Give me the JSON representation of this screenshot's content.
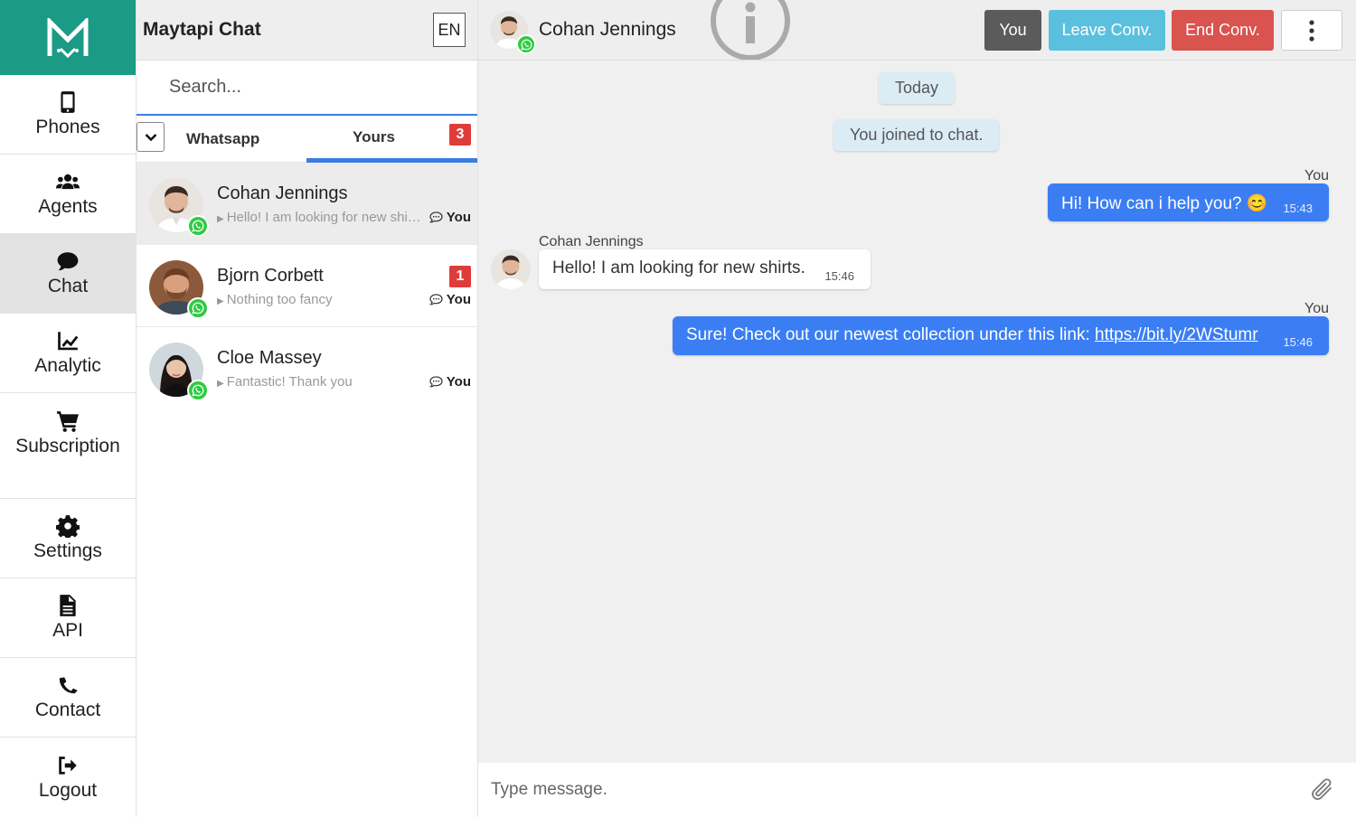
{
  "nav": {
    "items": [
      {
        "label": "Phones",
        "icon": "phone-icon"
      },
      {
        "label": "Agents",
        "icon": "users-icon"
      },
      {
        "label": "Chat",
        "icon": "comment-icon"
      },
      {
        "label": "Analytic",
        "icon": "chart-line-icon"
      },
      {
        "label": "Subscription",
        "icon": "cart-icon"
      },
      {
        "label": "Settings",
        "icon": "gear-icon"
      },
      {
        "label": "API",
        "icon": "file-icon"
      },
      {
        "label": "Contact",
        "icon": "phone-call-icon"
      },
      {
        "label": "Logout",
        "icon": "sign-out-icon"
      }
    ],
    "active": "Chat",
    "brand_color": "#1b9a85"
  },
  "list": {
    "title": "Maytapi Chat",
    "lang": "EN",
    "search_placeholder": "Search...",
    "tabs": {
      "whatsapp": "Whatsapp",
      "yours": "Yours",
      "yours_count": "3"
    },
    "conversations": [
      {
        "name": "Cohan Jennings",
        "preview": "Hello! I am looking for new shirts.",
        "owner": "You",
        "badge": "",
        "selected": true
      },
      {
        "name": "Bjorn Corbett",
        "preview": "Nothing too fancy",
        "owner": "You",
        "badge": "1",
        "selected": false
      },
      {
        "name": "Cloe Massey",
        "preview": "Fantastic! Thank you",
        "owner": "You",
        "badge": "",
        "selected": false
      }
    ]
  },
  "chat": {
    "contact_name": "Cohan Jennings",
    "buttons": {
      "you": "You",
      "leave": "Leave Conv.",
      "end": "End Conv."
    },
    "system": {
      "today": "Today",
      "joined": "You joined to chat."
    },
    "messages": [
      {
        "sender": "You",
        "text": "Hi! How can i help you? 😊",
        "time": "15:43",
        "direction": "out"
      },
      {
        "sender": "Cohan Jennings",
        "text": "Hello! I am looking for new shirts.",
        "time": "15:46",
        "direction": "in"
      },
      {
        "sender": "You",
        "text_prefix": "Sure! Check out our newest collection under this link: ",
        "link": "https://bit.ly/2WStumr",
        "time": "15:46",
        "direction": "out"
      }
    ],
    "composer_placeholder": "Type message."
  },
  "colors": {
    "accent_blue": "#3b7ef3",
    "badge_red": "#e03b3b",
    "whatsapp_green": "#2ecc40",
    "leave_button": "#5bc0de",
    "end_button": "#d9534f",
    "you_button": "#5b5b5b"
  }
}
